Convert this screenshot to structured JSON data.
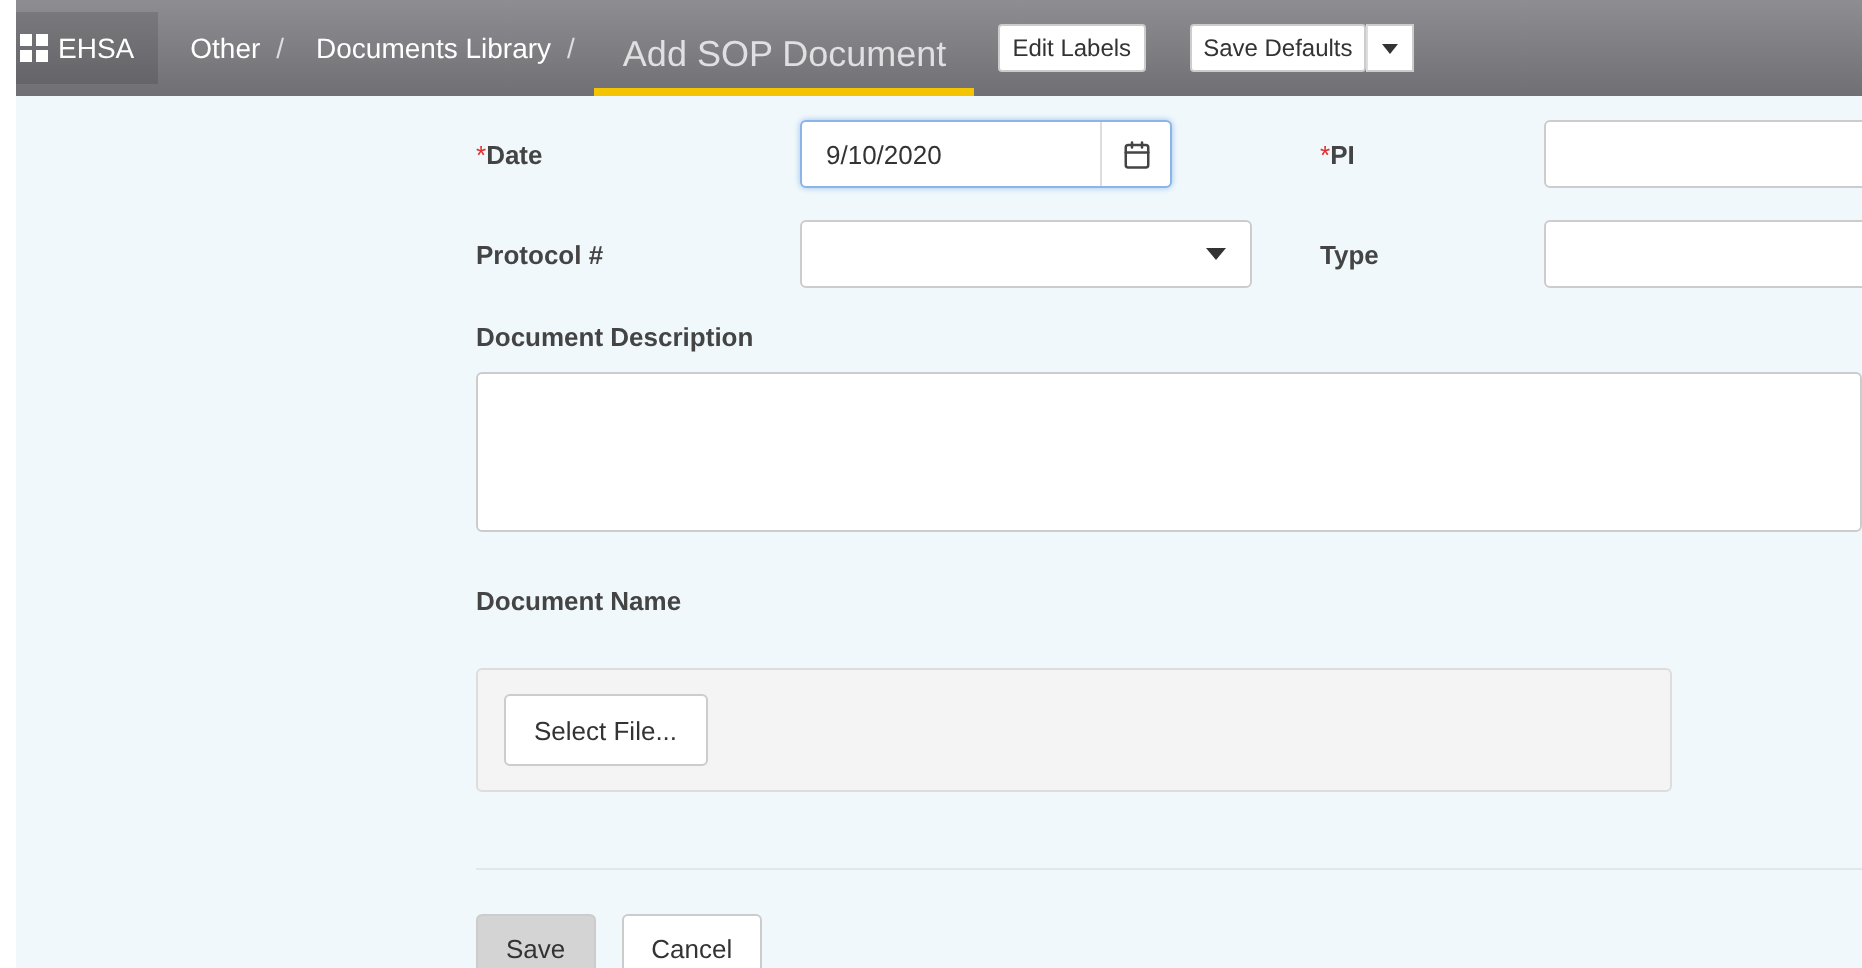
{
  "topbar": {
    "app": "EHSA",
    "breadcrumbs": [
      {
        "label": "Other",
        "separator": "/"
      },
      {
        "label": "Documents Library",
        "separator": "/"
      }
    ],
    "page_title": "Add SOP Document",
    "buttons": [
      {
        "label": "Edit Labels",
        "kind": "plain"
      },
      {
        "label": "Save Defaults",
        "kind": "split"
      }
    ]
  },
  "form": {
    "rows": [
      [
        {
          "label": "Date",
          "required_mark": "*",
          "kind": "date",
          "value": "9/10/2020",
          "focused": true
        },
        {
          "label": "PI",
          "required_mark": "*",
          "kind": "text",
          "focused": false
        }
      ],
      [
        {
          "label": "Protocol #",
          "kind": "select",
          "focused": false
        },
        {
          "label": "Type",
          "kind": "text",
          "focused": false
        }
      ]
    ],
    "description": {
      "label": "Document Description"
    },
    "document": {
      "label": "Document Name",
      "button": "Select File..."
    },
    "actions": [
      {
        "label": "Save",
        "kind": "primary"
      },
      {
        "label": "Cancel",
        "kind": "secondary"
      }
    ]
  }
}
